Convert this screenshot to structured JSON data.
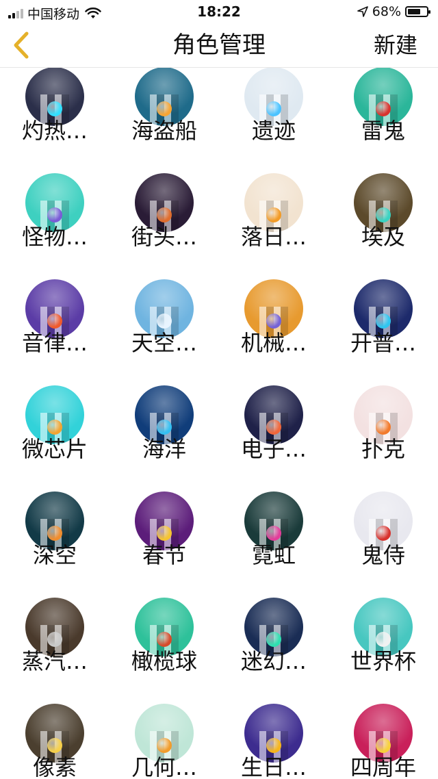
{
  "status": {
    "carrier": "中国移动",
    "time": "18:22",
    "battery": "68%",
    "battery_level": 0.68
  },
  "nav": {
    "back_icon": "chevron-left-icon",
    "title": "角色管理",
    "new_label": "新建"
  },
  "colors": {
    "accent": "#E5B12A"
  },
  "roles": [
    {
      "label": "灼热…",
      "bg": "#2b2f4a",
      "ball": "#31e0ff"
    },
    {
      "label": "海盗船",
      "bg": "#1f6b8a",
      "ball": "#f7a534"
    },
    {
      "label": "遗迹",
      "bg": "#dfe9f1",
      "ball": "#4cc3ff"
    },
    {
      "label": "雷鬼",
      "bg": "#2bb69a",
      "ball": "#d8332e"
    },
    {
      "label": "怪物…",
      "bg": "#3ed0c0",
      "ball": "#7a5bd6"
    },
    {
      "label": "街头…",
      "bg": "#2a1c36",
      "ball": "#e06d2d"
    },
    {
      "label": "落日…",
      "bg": "#f2e3d0",
      "ball": "#f29b27"
    },
    {
      "label": "埃及",
      "bg": "#5c4a2b",
      "ball": "#39d3c2"
    },
    {
      "label": "音律…",
      "bg": "#5b3ca6",
      "ball": "#f05a2c"
    },
    {
      "label": "天空…",
      "bg": "#6fb4e0",
      "ball": "#e8f4ff"
    },
    {
      "label": "机械…",
      "bg": "#e79a2f",
      "ball": "#7563d6"
    },
    {
      "label": "开普…",
      "bg": "#1d2a6b",
      "ball": "#2ec6f0"
    },
    {
      "label": "微芯片",
      "bg": "#32d2d9",
      "ball": "#f3a431"
    },
    {
      "label": "海洋",
      "bg": "#103d7a",
      "ball": "#35c0f2"
    },
    {
      "label": "电子…",
      "bg": "#1f2149",
      "ball": "#f0663a"
    },
    {
      "label": "扑克",
      "bg": "#f3e1e1",
      "ball": "#f27a2b"
    },
    {
      "label": "深空",
      "bg": "#123a47",
      "ball": "#f08d2e"
    },
    {
      "label": "春节",
      "bg": "#5c1d7a",
      "ball": "#f5c431"
    },
    {
      "label": "霓虹",
      "bg": "#1a3b3a",
      "ball": "#e23d9a"
    },
    {
      "label": "鬼侍",
      "bg": "#e8e8ef",
      "ball": "#d8322e"
    },
    {
      "label": "蒸汽…",
      "bg": "#4a3a2c",
      "ball": "#c9c9c9"
    },
    {
      "label": "橄榄球",
      "bg": "#2ec19a",
      "ball": "#d64a2a"
    },
    {
      "label": "迷幻…",
      "bg": "#1a2d55",
      "ball": "#2ee0b0"
    },
    {
      "label": "世界杯",
      "bg": "#47c7c0",
      "ball": "#f1f1f1"
    },
    {
      "label": "像素",
      "bg": "#4b3f2f",
      "ball": "#f6d04a"
    },
    {
      "label": "几何…",
      "bg": "#bfe6d7",
      "ball": "#f19c2c"
    },
    {
      "label": "生日…",
      "bg": "#3d2c8f",
      "ball": "#f6b51a"
    },
    {
      "label": "四周年",
      "bg": "#c9205a",
      "ball": "#f7d13a"
    }
  ]
}
